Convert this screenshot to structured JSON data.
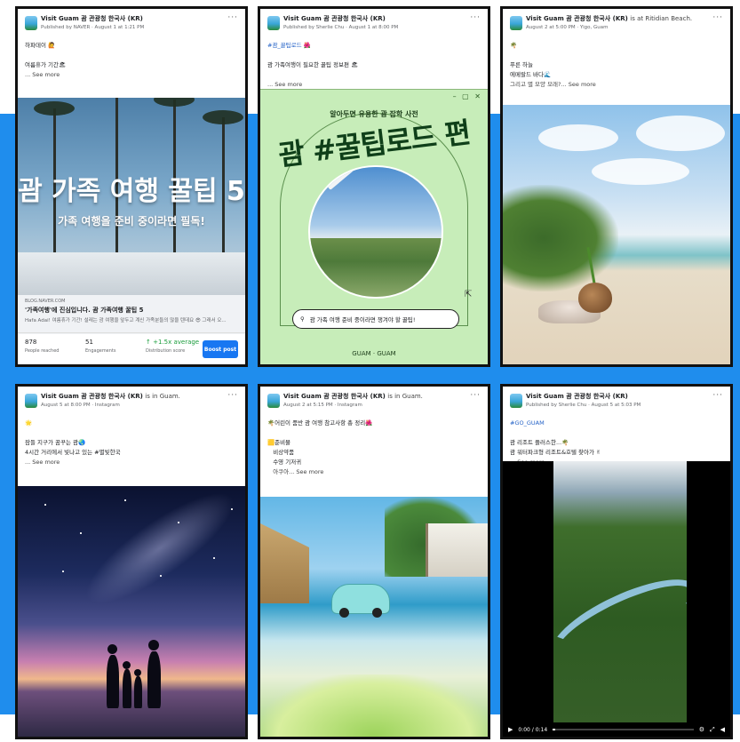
{
  "colors": {
    "background_band": "#1f8ded",
    "page_bg": "#ffffff",
    "link": "#2563c7",
    "boost_button": "#1877f2"
  },
  "more_icon": "···",
  "cards": [
    {
      "page_name": "Visit Guam 괌 관광청 한국사 (KR)",
      "location": "",
      "meta": "Published by NAVER · August 1 at 1:21 PM",
      "lines": [
        "하파데이 🙋",
        "",
        "여름휴가 기간🏖"
      ],
      "see_more": "... See more",
      "media": {
        "title": "괌 가족 여행 꿀팁 5",
        "subtitle": "가족 여행을 준비 중이라면 필독!"
      },
      "link": {
        "domain": "BLOG.NAVER.COM",
        "title": "'가족여행'에 진심입니다. 괌 가족여행 꿀팁 5",
        "desc": "Hafa Adai! 여름휴가 기간! 설레는 괌 여행을 앞두고 계신 가족분들의 많을 텐데요 😎 그래서 오..."
      },
      "stats": [
        {
          "value": "878",
          "label": "People reached"
        },
        {
          "value": "51",
          "label": "Engagements"
        },
        {
          "value": "↑ +1.5x average",
          "label": "Distribution score"
        }
      ],
      "boost": "Boost post"
    },
    {
      "page_name": "Visit Guam 괌 관광청 한국사 (KR)",
      "location": "",
      "meta": "Published by Sherlie Chu · August 1 at 8:00 PM",
      "lines": [
        "#괌_꿀팁로드 🌺",
        "",
        "괌 가족여행이 필요한 꿀팁 정보편 🏖"
      ],
      "see_more": "... See more",
      "media": {
        "small": "알아두면 유용한 괌 잡학 사전",
        "big": "괌 #꿀팁로드 편",
        "search": "괌 가족 여행 준비 중이라면 챙겨야 할 꿀팁!",
        "logos": "GUAM · GUAM",
        "window_controls": "– ▢ ✕"
      }
    },
    {
      "page_name": "Visit Guam 괌 관광청 한국사 (KR)",
      "location": "is at Ritidian Beach.",
      "meta": "August 2 at 5:00 PM · Yigo, Guam",
      "lines": [
        "🌴",
        "",
        "푸른 하늘",
        "에메랄드 바다🌊",
        "그리고 별 모양 모래?... See more"
      ],
      "see_more": ""
    },
    {
      "page_name": "Visit Guam 괌 관광청 한국사 (KR)",
      "location": "is in Guam.",
      "meta": "August 5 at 8:00 PM · Instagram",
      "lines": [
        "🌟",
        "",
        "잠들 지구가 꿈꾸는 괌🌏",
        "4시간 거리에서 빛나고 있는 #별빛한국"
      ],
      "see_more": "... See more"
    },
    {
      "page_name": "Visit Guam 괌 관광청 한국사 (KR)",
      "location": "is in Guam.",
      "meta": "August 2 at 5:15 PM · Instagram",
      "lines": [
        "🌴어린이 품반 괌 여행 참고사항 총 정리🌺",
        "",
        "🟨준비물",
        "   비상약품",
        "   수영 기저귀",
        "   아쿠아... See more"
      ],
      "see_more": ""
    },
    {
      "page_name": "Visit Guam 괌 관광청 한국사 (KR)",
      "location": "",
      "meta": "Published by Sherlie Chu · August 5 at 5:03 PM",
      "lines": [
        "#GO_GUAM",
        "",
        "괌 리조트 플러스한...🌴",
        "괌 워터파크형 리조트&호텔 찾아가 ✌"
      ],
      "see_more": "... See more",
      "video": {
        "time": "0:00 / 0:14",
        "progress": 0.02
      }
    }
  ]
}
